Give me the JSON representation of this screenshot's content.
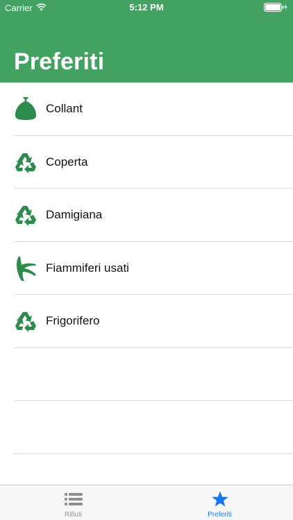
{
  "status_bar": {
    "carrier": "Carrier",
    "time": "5:12 PM",
    "icons": [
      "wifi-icon",
      "battery-icon"
    ]
  },
  "header": {
    "title": "Preferiti"
  },
  "favorites": [
    {
      "label": "Collant",
      "icon": "bag-icon"
    },
    {
      "label": "Coperta",
      "icon": "recycle-icon"
    },
    {
      "label": "Damigiana",
      "icon": "recycle-icon"
    },
    {
      "label": "Fiammiferi usati",
      "icon": "banana-peel-icon"
    },
    {
      "label": "Frigorifero",
      "icon": "recycle-icon"
    }
  ],
  "tabbar": {
    "tabs": [
      {
        "label": "Rifiuti",
        "icon": "list-icon",
        "selected": false
      },
      {
        "label": "Preferiti",
        "icon": "star-icon",
        "selected": true
      }
    ]
  },
  "colors": {
    "header": "#43a162",
    "icon_green": "#2e8b4e",
    "tab_active": "#1478f5",
    "tab_inactive": "#8e8e93"
  }
}
